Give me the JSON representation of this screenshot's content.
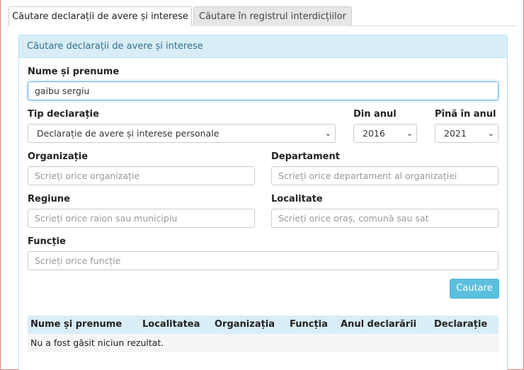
{
  "tabs": [
    {
      "label": "Căutare declarații de avere și interese"
    },
    {
      "label": "Căutare în registrul interdicțiilor"
    }
  ],
  "panel": {
    "title": "Căutare declarații de avere și interese"
  },
  "form": {
    "name_label": "Nume și prenume",
    "name_value": "gaibu sergiu",
    "type_label": "Tip declarație",
    "type_value": "Declarație de avere și interese personale",
    "from_label": "Din anul",
    "from_value": "2016",
    "to_label": "Pînă în anul",
    "to_value": "2021",
    "org_label": "Organizație",
    "org_placeholder": "Scrieți orice organizație",
    "dept_label": "Departament",
    "dept_placeholder": "Scrieți orice departament al organizației",
    "region_label": "Regiune",
    "region_placeholder": "Scrieți orice raion sau municipiu",
    "locality_label": "Localitate",
    "locality_placeholder": "Scrieți orice oraș, comună sau sat",
    "function_label": "Funcție",
    "function_placeholder": "Scrieți orice funcție",
    "search_button": "Cautare"
  },
  "results": {
    "columns": [
      "Nume și prenume",
      "Localitatea",
      "Organizația",
      "Funcția",
      "Anul declarării",
      "Declarație"
    ],
    "empty_message": "Nu a fost găsit niciun rezultat."
  },
  "colors": {
    "accent": "#5bc0de",
    "panel_heading": "#d9edf7"
  }
}
